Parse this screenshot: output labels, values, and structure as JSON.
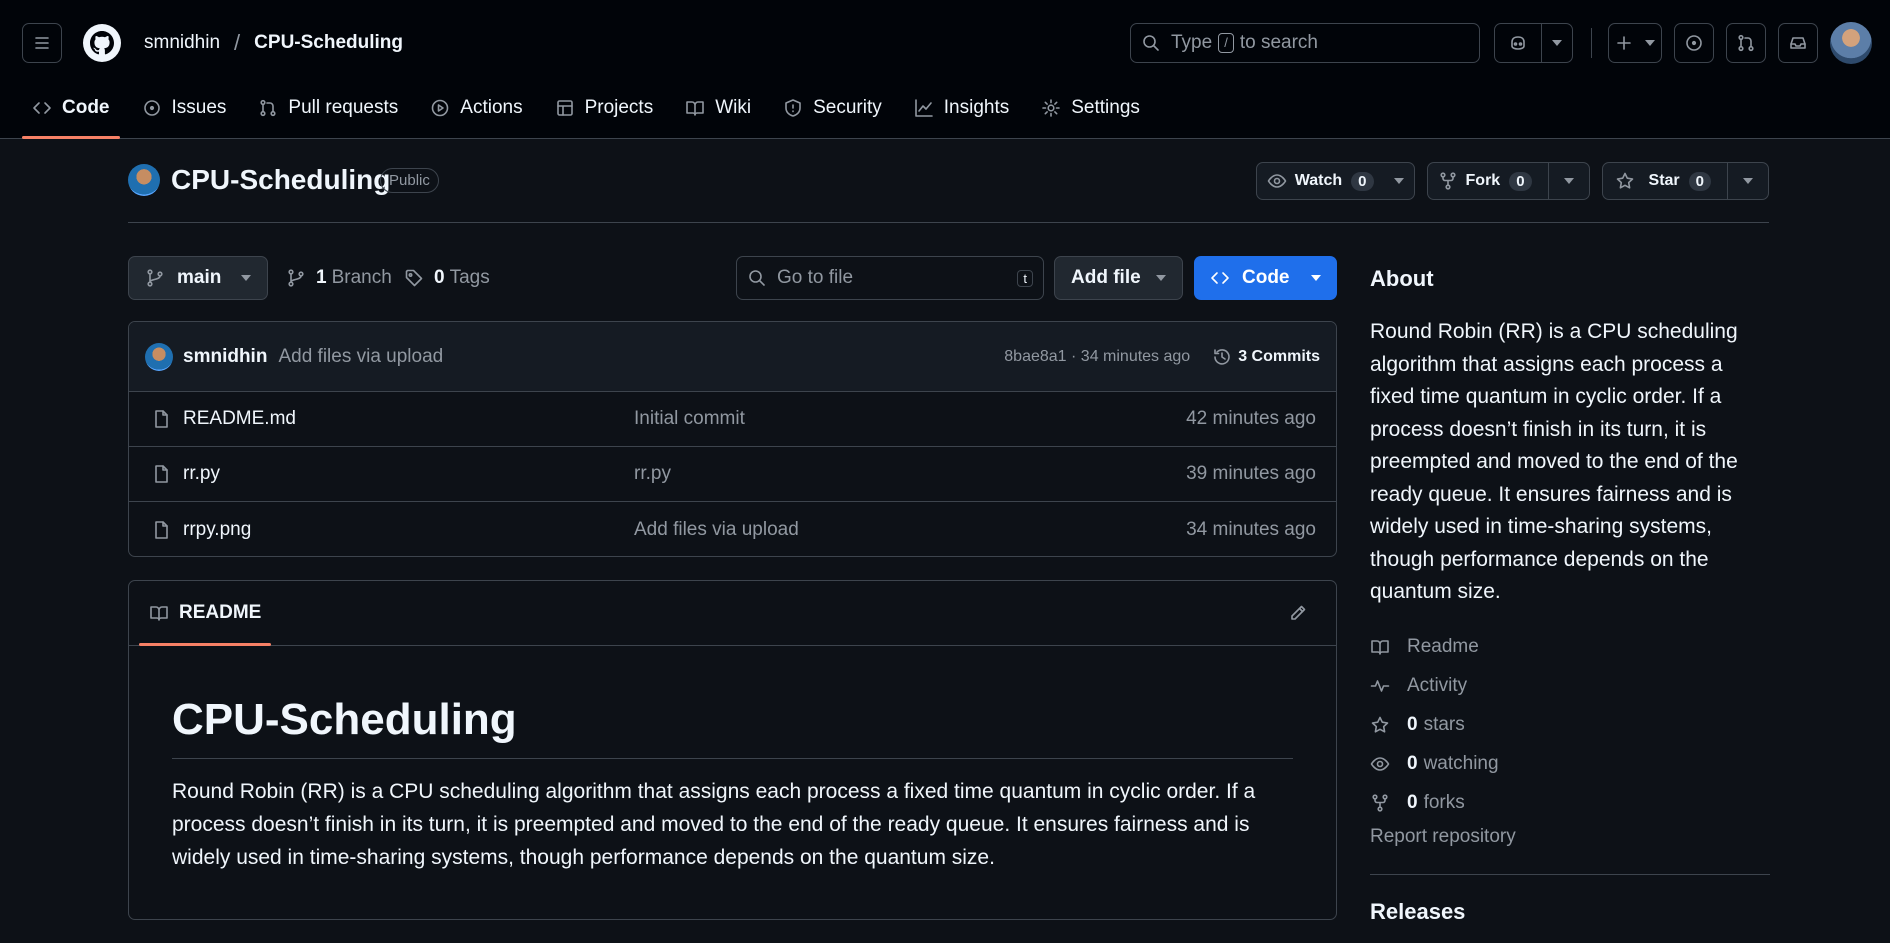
{
  "header": {
    "owner": "smnidhin",
    "separator": "/",
    "repo": "CPU-Scheduling",
    "search_prefix": "Type",
    "search_key": "/",
    "search_suffix": "to search"
  },
  "nav": {
    "tabs": [
      {
        "label": "Code",
        "icon": "code-icon",
        "active": true
      },
      {
        "label": "Issues",
        "icon": "issue-icon"
      },
      {
        "label": "Pull requests",
        "icon": "pull-request-icon"
      },
      {
        "label": "Actions",
        "icon": "play-icon"
      },
      {
        "label": "Projects",
        "icon": "table-icon"
      },
      {
        "label": "Wiki",
        "icon": "book-icon"
      },
      {
        "label": "Security",
        "icon": "shield-icon"
      },
      {
        "label": "Insights",
        "icon": "graph-icon"
      },
      {
        "label": "Settings",
        "icon": "gear-icon"
      }
    ]
  },
  "repo_header": {
    "name": "CPU-Scheduling",
    "visibility": "Public",
    "watch": {
      "label": "Watch",
      "count": "0"
    },
    "fork": {
      "label": "Fork",
      "count": "0"
    },
    "star": {
      "label": "Star",
      "count": "0"
    }
  },
  "toolbar": {
    "branch": "main",
    "branches_count": "1",
    "branches_label": "Branch",
    "tags_count": "0",
    "tags_label": "Tags",
    "goto_placeholder": "Go to file",
    "goto_key": "t",
    "add_file": "Add file",
    "code": "Code"
  },
  "latest_commit": {
    "author": "smnidhin",
    "message": "Add files via upload",
    "sha_time": "8bae8a1 · 34 minutes ago",
    "commits": "3 Commits"
  },
  "files": [
    {
      "name": "README.md",
      "message": "Initial commit",
      "time": "42 minutes ago"
    },
    {
      "name": "rr.py",
      "message": "rr.py",
      "time": "39 minutes ago"
    },
    {
      "name": "rrpy.png",
      "message": "Add files via upload",
      "time": "34 minutes ago"
    }
  ],
  "readme": {
    "tab": "README",
    "title": "CPU-Scheduling",
    "body": "Round Robin (RR) is a CPU scheduling algorithm that assigns each process a fixed time quantum in cyclic order. If a process doesn’t finish in its turn, it is preempted and moved to the end of the ready queue. It ensures fairness and is widely used in time-sharing systems, though performance depends on the quantum size."
  },
  "about": {
    "title": "About",
    "description": "Round Robin (RR) is a CPU scheduling algorithm that assigns each process a fixed time quantum in cyclic order. If a process doesn’t finish in its turn, it is preempted and moved to the end of the ready queue. It ensures fairness and is widely used in time-sharing systems, though performance depends on the quantum size.",
    "readme": "Readme",
    "activity": "Activity",
    "stars_count": "0",
    "stars_label": "stars",
    "watching_count": "0",
    "watching_label": "watching",
    "forks_count": "0",
    "forks_label": "forks",
    "report": "Report repository",
    "releases": "Releases"
  },
  "colors": {
    "background": "#0d1117",
    "header_bg": "#010409",
    "border": "#3d444d",
    "accent_tab": "#f78166",
    "primary_button": "#1f6feb",
    "muted_text": "#9198a1"
  }
}
